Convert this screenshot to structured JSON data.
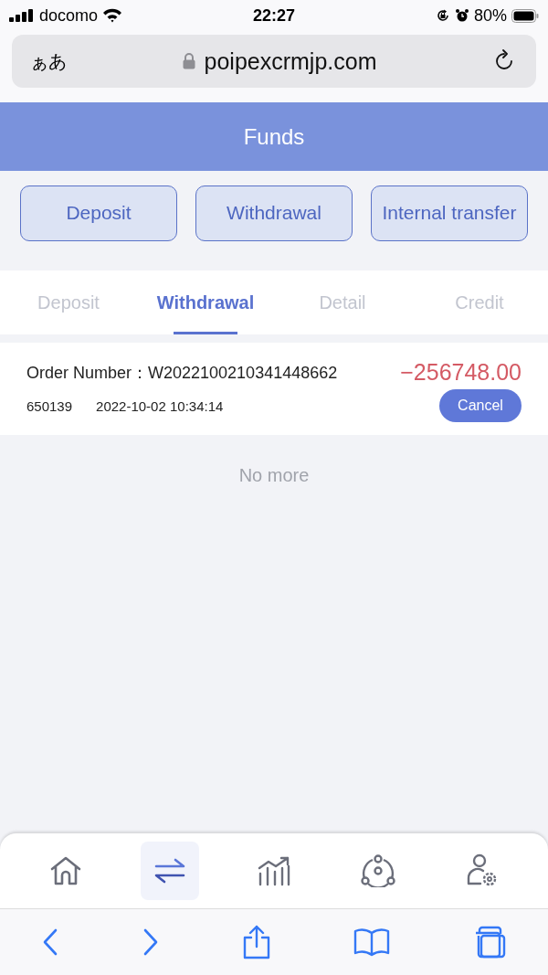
{
  "status_bar": {
    "carrier": "docomo",
    "time": "22:27",
    "battery": "80%"
  },
  "browser": {
    "text_size": "ぁあ",
    "url": "poipexcrmjp.com"
  },
  "header": {
    "title": "Funds"
  },
  "actions": [
    "Deposit",
    "Withdrawal",
    "Internal transfer"
  ],
  "tabs": [
    {
      "label": "Deposit",
      "selected": false
    },
    {
      "label": "Withdrawal",
      "selected": true
    },
    {
      "label": "Detail",
      "selected": false
    },
    {
      "label": "Credit",
      "selected": false
    }
  ],
  "records": [
    {
      "order_label": "Order Number：",
      "order_number": "W2022100210341448662",
      "amount": "−256748.00",
      "code": "650139",
      "datetime": "2022-10-02 10:34:14",
      "action": "Cancel"
    }
  ],
  "end_note": "No more",
  "bottom_nav": [
    {
      "kind": "home",
      "selected": false
    },
    {
      "kind": "transfer",
      "selected": true
    },
    {
      "kind": "chart",
      "selected": false
    },
    {
      "kind": "network",
      "selected": false
    },
    {
      "kind": "account",
      "selected": false
    }
  ]
}
